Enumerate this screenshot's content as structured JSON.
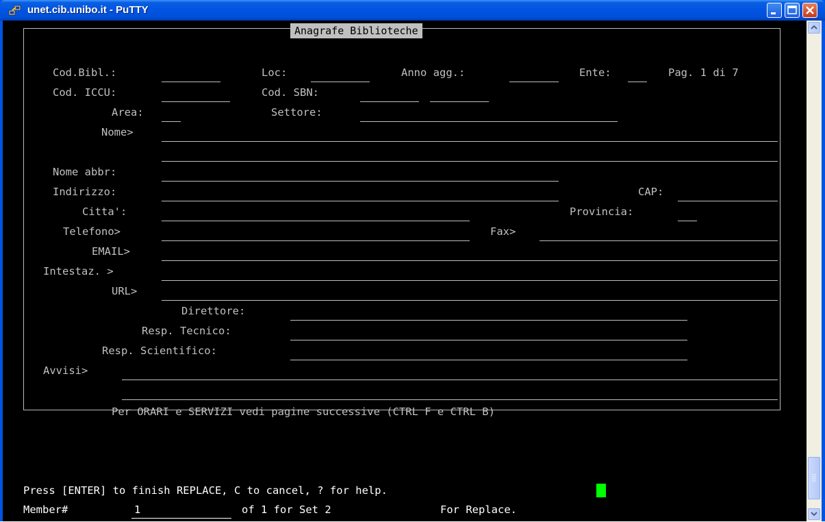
{
  "window": {
    "title": "unet.cib.unibo.it - PuTTY"
  },
  "form": {
    "title": "Anagrafe Biblioteche",
    "cod_bibl": "Cod.Bibl.:",
    "loc": "Loc:",
    "anno_agg": "Anno agg.:",
    "ente": "Ente:",
    "pag": "Pag. 1 di 7",
    "cod_iccu": "Cod. ICCU:",
    "cod_sbn": "Cod. SBN:",
    "area": "Area:",
    "settore": "Settore:",
    "nome": "Nome>",
    "nome_abbr": "Nome abbr:",
    "indirizzo": "Indirizzo:",
    "cap": "CAP:",
    "citta": "Citta':",
    "provincia": "Provincia:",
    "telefono": "Telefono>",
    "fax": "Fax>",
    "email": "EMAIL>",
    "intestaz": "Intestaz. >",
    "url": "URL>",
    "direttore": "Direttore:",
    "resp_tecnico": "Resp. Tecnico:",
    "resp_scientifico": "Resp. Scientifico:",
    "avvisi": "Avvisi>",
    "footer_note": "Per ORARI e SERVIZI vedi pagine successive (CTRL F e CTRL B)"
  },
  "prompt": {
    "message": "Press [ENTER] to finish REPLACE, C to cancel, ? for help.",
    "member_label": "Member#",
    "member_value": "1",
    "set_info": "of 1 for Set 2",
    "mode": "For Replace."
  },
  "colors": {
    "terminal_bg": "#000000",
    "terminal_text": "#c0c0c0",
    "cursor": "#00ff00",
    "titlebar": "#0054e3"
  }
}
